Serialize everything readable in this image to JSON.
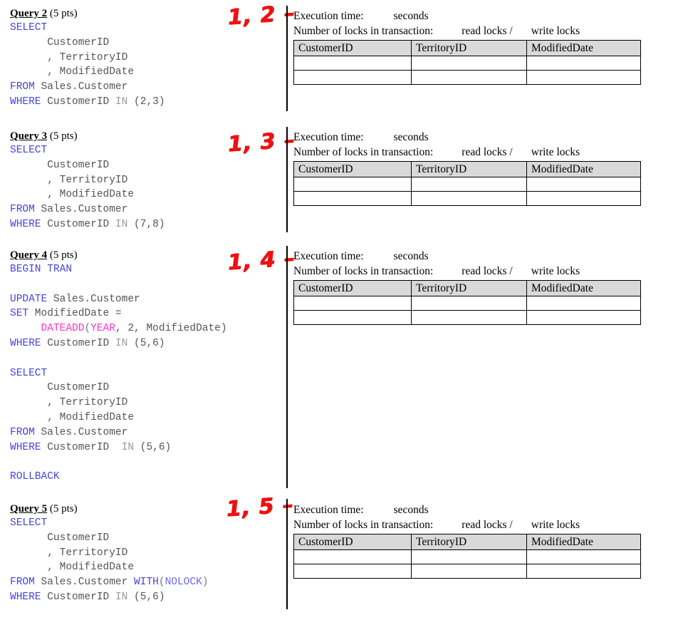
{
  "document": {
    "kind": "sql-exercise-worksheet",
    "accent_red": "#ee1111",
    "keyword_color": "#4444dd",
    "function_color": "#ff33cc",
    "identifier_color": "#555555",
    "table_header_bg": "#d9d9d9"
  },
  "result_panel": {
    "execution_time_label": "Execution time:",
    "execution_time_unit": "seconds",
    "locks_label": "Number of locks in transaction:",
    "read_locks_label": "read locks /",
    "write_locks_label": "write locks",
    "columns": [
      "CustomerID",
      "TerritoryID",
      "ModifiedDate"
    ],
    "rows": [
      [
        "",
        "",
        ""
      ],
      [
        "",
        "",
        ""
      ]
    ]
  },
  "blocks": [
    {
      "id": "query-2",
      "title_underlined": "Query 2",
      "title_points": " (5 pts)",
      "annotation": "1, 2 –",
      "code_lines": [
        [
          {
            "t": "SELECT",
            "c": "kw"
          }
        ],
        [
          {
            "t": "      CustomerID",
            "c": "id"
          }
        ],
        [
          {
            "t": "      , TerritoryID",
            "c": "id"
          }
        ],
        [
          {
            "t": "      , ModifiedDate",
            "c": "id"
          }
        ],
        [
          {
            "t": "FROM",
            "c": "kw"
          },
          {
            "t": " Sales.Customer",
            "c": "id"
          }
        ],
        [
          {
            "t": "WHERE",
            "c": "kw"
          },
          {
            "t": " CustomerID ",
            "c": "id"
          },
          {
            "t": "IN",
            "c": "dim"
          },
          {
            "t": " (2,3)",
            "c": "id"
          }
        ]
      ]
    },
    {
      "id": "query-3",
      "title_underlined": "Query 3",
      "title_points": " (5 pts)",
      "annotation": "1, 3 –",
      "code_lines": [
        [
          {
            "t": "SELECT",
            "c": "kw"
          }
        ],
        [
          {
            "t": "      CustomerID",
            "c": "id"
          }
        ],
        [
          {
            "t": "      , TerritoryID",
            "c": "id"
          }
        ],
        [
          {
            "t": "      , ModifiedDate",
            "c": "id"
          }
        ],
        [
          {
            "t": "FROM",
            "c": "kw"
          },
          {
            "t": " Sales.Customer",
            "c": "id"
          }
        ],
        [
          {
            "t": "WHERE",
            "c": "kw"
          },
          {
            "t": " CustomerID ",
            "c": "id"
          },
          {
            "t": "IN",
            "c": "dim"
          },
          {
            "t": " (7,8)",
            "c": "id"
          }
        ]
      ]
    },
    {
      "id": "query-4",
      "title_underlined": "Query 4",
      "title_points": " (5 pts)",
      "annotation": "1, 4 –",
      "code_lines": [
        [
          {
            "t": "BEGIN TRAN",
            "c": "kw"
          }
        ],
        [
          {
            "t": "",
            "c": "blank"
          }
        ],
        [
          {
            "t": "UPDATE",
            "c": "kw"
          },
          {
            "t": " Sales.Customer",
            "c": "id"
          }
        ],
        [
          {
            "t": "SET",
            "c": "kw"
          },
          {
            "t": " ModifiedDate =",
            "c": "id"
          }
        ],
        [
          {
            "t": "     ",
            "c": "id"
          },
          {
            "t": "DATEADD",
            "c": "fn"
          },
          {
            "t": "(",
            "c": "punc"
          },
          {
            "t": "YEAR",
            "c": "fn"
          },
          {
            "t": ", 2, ModifiedDate)",
            "c": "id"
          }
        ],
        [
          {
            "t": "WHERE",
            "c": "kw"
          },
          {
            "t": " CustomerID ",
            "c": "id"
          },
          {
            "t": "IN",
            "c": "dim"
          },
          {
            "t": " (5,6)",
            "c": "id"
          }
        ],
        [
          {
            "t": "",
            "c": "blank"
          }
        ],
        [
          {
            "t": "SELECT",
            "c": "kw"
          }
        ],
        [
          {
            "t": "      CustomerID",
            "c": "id"
          }
        ],
        [
          {
            "t": "      , TerritoryID",
            "c": "id"
          }
        ],
        [
          {
            "t": "      , ModifiedDate",
            "c": "id"
          }
        ],
        [
          {
            "t": "FROM",
            "c": "kw"
          },
          {
            "t": " Sales.Customer",
            "c": "id"
          }
        ],
        [
          {
            "t": "WHERE",
            "c": "kw"
          },
          {
            "t": " CustomerID  ",
            "c": "id"
          },
          {
            "t": "IN",
            "c": "dim"
          },
          {
            "t": " (5,6)",
            "c": "id"
          }
        ],
        [
          {
            "t": "",
            "c": "blank"
          }
        ],
        [
          {
            "t": "ROLLBACK",
            "c": "kw"
          }
        ]
      ]
    },
    {
      "id": "query-5",
      "title_underlined": "Query 5",
      "title_points": " (5 pts)",
      "annotation": "1, 5 –",
      "code_lines": [
        [
          {
            "t": "SELECT",
            "c": "kw"
          }
        ],
        [
          {
            "t": "      CustomerID",
            "c": "id"
          }
        ],
        [
          {
            "t": "      , TerritoryID",
            "c": "id"
          }
        ],
        [
          {
            "t": "      , ModifiedDate",
            "c": "id"
          }
        ],
        [
          {
            "t": "FROM",
            "c": "kw"
          },
          {
            "t": " Sales.Customer ",
            "c": "id"
          },
          {
            "t": "WITH",
            "c": "kw"
          },
          {
            "t": "(",
            "c": "punc"
          },
          {
            "t": "NOLOCK",
            "c": "kw2"
          },
          {
            "t": ")",
            "c": "punc"
          }
        ],
        [
          {
            "t": "WHERE",
            "c": "kw"
          },
          {
            "t": " CustomerID ",
            "c": "id"
          },
          {
            "t": "IN",
            "c": "dim"
          },
          {
            "t": " (5,6)",
            "c": "id"
          }
        ]
      ]
    }
  ]
}
